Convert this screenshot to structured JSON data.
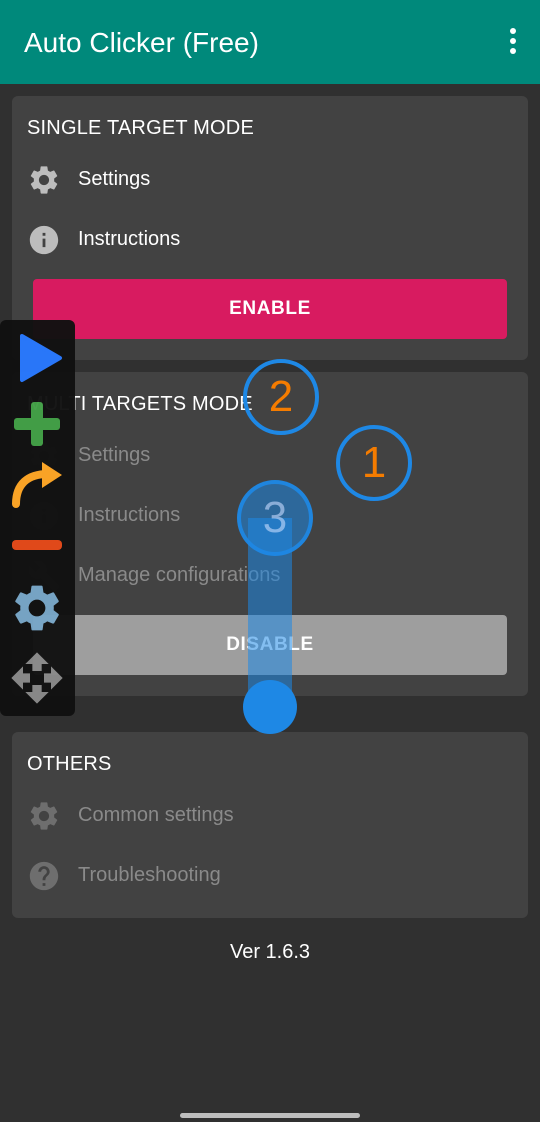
{
  "app_bar": {
    "title": "Auto Clicker (Free)",
    "overflow_icon": "more-vert-icon",
    "color": "#00897b"
  },
  "single_target": {
    "title": "SINGLE TARGET MODE",
    "settings_label": "Settings",
    "instructions_label": "Instructions",
    "button_label": "ENABLE",
    "button_color": "#d81b60"
  },
  "multi_target": {
    "title": "MULTI TARGETS MODE",
    "settings_label": "Settings",
    "instructions_label": "Instructions",
    "manage_label": "Manage configurations",
    "button_label": "DISABLE",
    "button_color": "#9e9e9e"
  },
  "others": {
    "title": "OTHERS",
    "common_settings_label": "Common settings",
    "troubleshooting_label": "Troubleshooting"
  },
  "version": "Ver 1.6.3",
  "toolbar": {
    "icons": [
      "play-icon",
      "add-icon",
      "redo-arrow-icon",
      "remove-icon",
      "gear-icon",
      "move-icon"
    ]
  },
  "targets": {
    "t1": "1",
    "t2": "2",
    "t3": "3"
  }
}
